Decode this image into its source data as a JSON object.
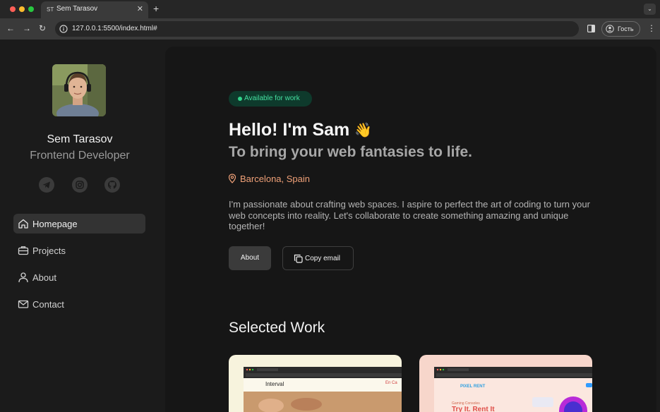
{
  "browser": {
    "tab_favicon": "ST",
    "tab_title": "Sem Tarasov",
    "url": "127.0.0.1:5500/index.html#",
    "guest_label": "Гость"
  },
  "profile": {
    "name": "Sem Tarasov",
    "role": "Frontend Developer"
  },
  "social": [
    "telegram-icon",
    "instagram-icon",
    "github-icon"
  ],
  "nav": {
    "items": [
      {
        "label": "Homepage",
        "icon": "home-icon",
        "active": true
      },
      {
        "label": "Projects",
        "icon": "briefcase-icon",
        "active": false
      },
      {
        "label": "About",
        "icon": "user-icon",
        "active": false
      },
      {
        "label": "Contact",
        "icon": "mail-icon",
        "active": false
      }
    ]
  },
  "hero": {
    "badge": "Available for work",
    "title": "Hello! I'm Sam",
    "wave": "👋",
    "subtitle": "To bring your web fantasies to life.",
    "location": "Barcelona, Spain",
    "intro": "I'm passionate about crafting web spaces. I aspire to perfect the art of coding to turn your web concepts into reality. Let's collaborate to create something amazing and unique together!",
    "about_button": "About",
    "copy_button": "Copy email"
  },
  "work": {
    "title": "Selected Work",
    "cards": [
      {
        "name": "Interval",
        "nav_letters": "En  Ca"
      },
      {
        "name": "PIXEL RENT",
        "headline": "Try It. Rent It",
        "tagline": "Gaming Consoles"
      }
    ]
  },
  "colors": {
    "accent_green": "#31d38a",
    "location_orange": "#f0a178",
    "card_cream": "#f7f3dd",
    "card_pink": "#f7d6cb"
  }
}
